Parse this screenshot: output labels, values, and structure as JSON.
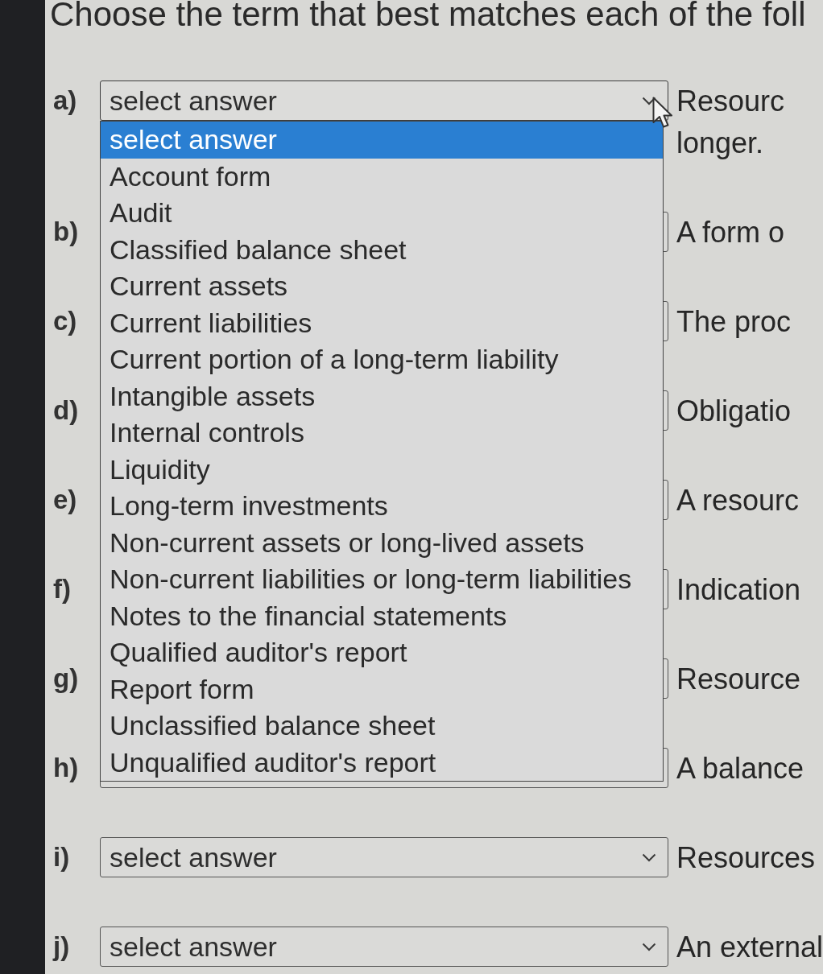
{
  "title": "Choose the term that best matches each of the foll",
  "rows": [
    {
      "letter": "a)",
      "select": {
        "value": "select answer",
        "expanded": true,
        "options": [
          {
            "label": "select answer",
            "selected": true
          },
          {
            "label": "Account form",
            "selected": false
          },
          {
            "label": "Audit",
            "selected": false
          },
          {
            "label": "Classified balance sheet",
            "selected": false
          },
          {
            "label": "Current assets",
            "selected": false
          },
          {
            "label": "Current liabilities",
            "selected": false
          },
          {
            "label": "Current portion of a long-term liability",
            "selected": false
          },
          {
            "label": "Intangible assets",
            "selected": false
          },
          {
            "label": "Internal controls",
            "selected": false
          },
          {
            "label": "Liquidity",
            "selected": false
          },
          {
            "label": "Long-term investments",
            "selected": false
          },
          {
            "label": "Non-current assets or long-lived assets",
            "selected": false
          },
          {
            "label": "Non-current liabilities or long-term liabilities",
            "selected": false
          },
          {
            "label": "Notes to the financial statements",
            "selected": false
          },
          {
            "label": "Qualified auditor's report",
            "selected": false
          },
          {
            "label": "Report form",
            "selected": false
          },
          {
            "label": "Unclassified balance sheet",
            "selected": false
          },
          {
            "label": "Unqualified auditor's report",
            "selected": false
          }
        ]
      },
      "description": "Resourc\nlonger."
    },
    {
      "letter": "b)",
      "description": "A form o"
    },
    {
      "letter": "c)",
      "description": "The proc"
    },
    {
      "letter": "d)",
      "description": "Obligatio"
    },
    {
      "letter": "e)",
      "description": "A resourc"
    },
    {
      "letter": "f)",
      "description": "Indication"
    },
    {
      "letter": "g)",
      "description": "Resource"
    },
    {
      "letter": "h)",
      "description": "A balance"
    },
    {
      "letter": "i)",
      "select": {
        "value": "select answer",
        "expanded": false
      },
      "description": "Resources"
    },
    {
      "letter": "j)",
      "select": {
        "value": "select answer",
        "expanded": false
      },
      "description": "An external"
    }
  ]
}
